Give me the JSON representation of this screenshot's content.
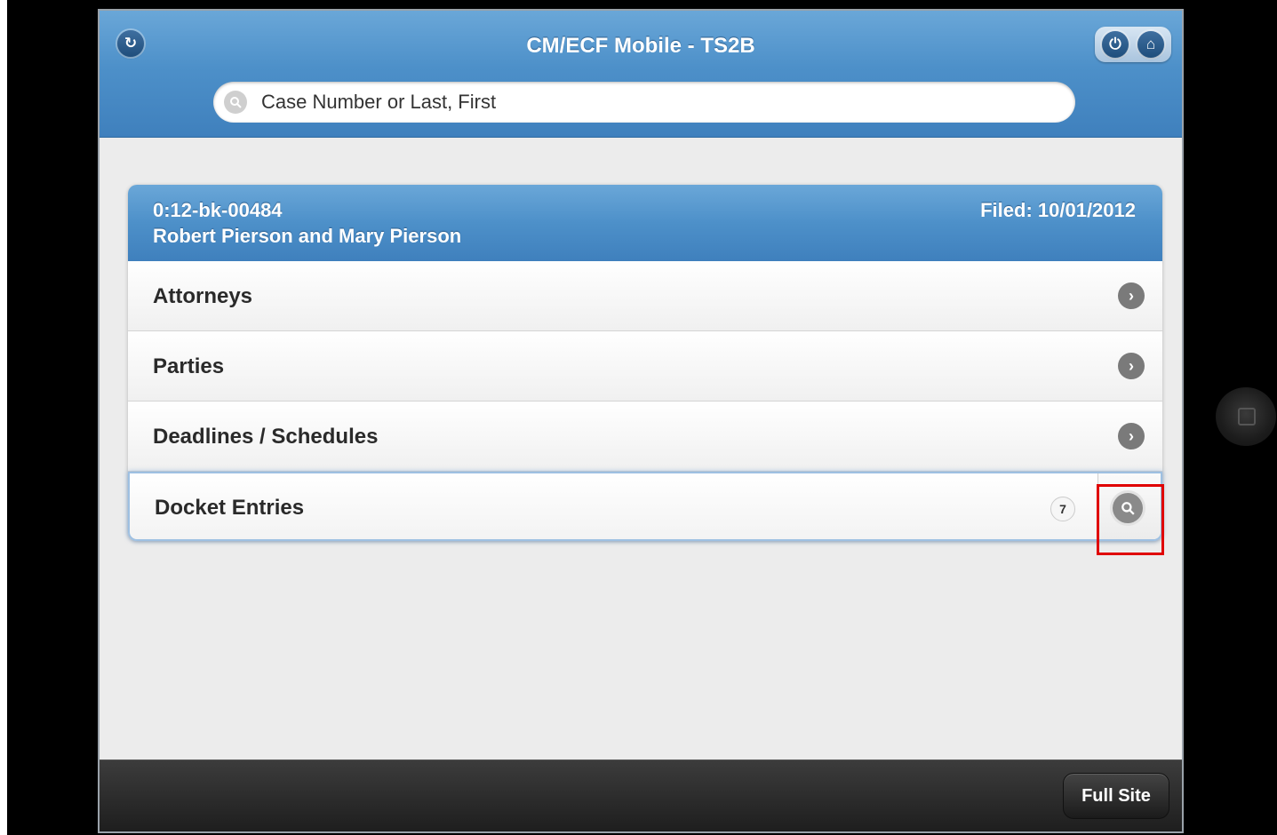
{
  "header": {
    "title": "CM/ECF Mobile - TS2B",
    "back_icon": "↻",
    "power_icon": "⏻",
    "home_icon": "⌂"
  },
  "search": {
    "placeholder": "Case Number or Last, First",
    "value": ""
  },
  "case": {
    "number": "0:12-bk-00484",
    "parties": "Robert Pierson and Mary Pierson",
    "filed": "Filed: 10/01/2012"
  },
  "menu": {
    "items": [
      {
        "label": "Attorneys"
      },
      {
        "label": "Parties"
      },
      {
        "label": "Deadlines / Schedules"
      }
    ],
    "docket": {
      "label": "Docket Entries",
      "count": "7"
    }
  },
  "footer": {
    "full_site_label": "Full Site"
  },
  "colors": {
    "header_blue": "#4d90c9",
    "highlight_red": "#e00000",
    "footer_dark": "#1e1e1e"
  }
}
